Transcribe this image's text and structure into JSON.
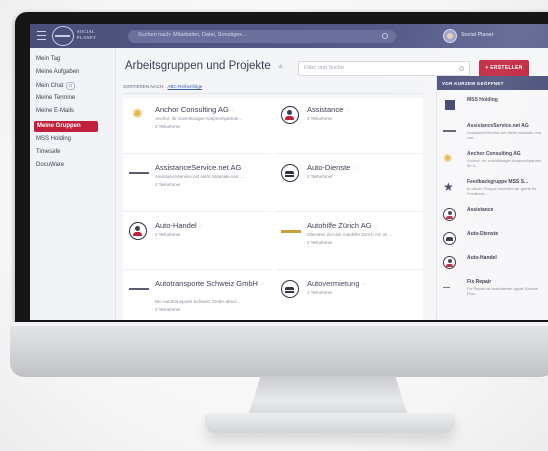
{
  "header": {
    "logo_text": "SOCIAL PLANET",
    "search_placeholder": "Suchen nach: Mitarbeiter, Datei, Sonstiges...",
    "user_name": "Social Planet"
  },
  "sidebar": {
    "items": [
      {
        "label": "Mein Tag"
      },
      {
        "label": "Meine Aufgaben"
      },
      {
        "label": "Mein Chat",
        "count": "0"
      },
      {
        "label": "Meine Termine"
      },
      {
        "label": "Meine E-Mails"
      },
      {
        "label": "Meine Gruppen",
        "active": true
      },
      {
        "label": "MSS Holding"
      },
      {
        "label": "Timesafe"
      },
      {
        "label": "DocuWare"
      }
    ]
  },
  "main": {
    "title": "Arbeitsgruppen und Projekte",
    "filter_placeholder": "Filter und Suche",
    "create_label": "+ ERSTELLEN",
    "sort_label": "SORTIEREN NACH:",
    "sort_value": "ABC-Reihenfolge",
    "groups": [
      {
        "title": "Anchor Consulting AG",
        "desc": "Anchor, Ihr zuverlässiger Ansprechpartner...",
        "members": "2 Teilnehmer",
        "icon": "sun-logo-icon"
      },
      {
        "title": "Assistance",
        "desc": "",
        "members": "3 Teilnehmer",
        "icon": "people-icon"
      },
      {
        "title": "AssistanceService.net AG",
        "desc": "AssistanceService.net steht nationale und ...",
        "members": "2 Teilnehmer",
        "icon": "company-logo-icon"
      },
      {
        "title": "Auto-Dienste",
        "desc": "",
        "members": "2 Teilnehmer",
        "icon": "car-icon"
      },
      {
        "title": "Auto-Handel",
        "desc": "",
        "members": "2 Teilnehmer",
        "icon": "people-icon"
      },
      {
        "title": "Autohilfe Zürich AG",
        "desc": "Oberstes Ziel der Autohilfe Zürich AG ist ...",
        "members": "2 Teilnehmer",
        "icon": "company-logo-icon"
      },
      {
        "title": "Autotransporte Schweiz GmbH",
        "desc": "Die Autotransporte Schweiz GmbH absol...",
        "members": "2 Teilnehmer",
        "icon": "company-logo-icon"
      },
      {
        "title": "Autovermietung",
        "desc": "",
        "members": "1 Teilnehmer",
        "icon": "car-icon"
      }
    ]
  },
  "recent": {
    "heading": "VOR KURZEM GEÖFFNET",
    "items": [
      {
        "title": "MSS Holding",
        "desc": "",
        "icon": "square-logo-icon"
      },
      {
        "title": "AssistanceService.net AG",
        "desc": "AssistanceService.net steht nationale und inte...",
        "icon": "company-logo-icon"
      },
      {
        "title": "Anchor Consulting AG",
        "desc": "Anchor, Ihr zuverlässiger Ansprechpartner für d...",
        "icon": "sun-logo-icon"
      },
      {
        "title": "Feedbackgruppe MSS S...",
        "desc": "In dieser Gruppe möchten wir gerne Ihr Feedback...",
        "icon": "star-icon"
      },
      {
        "title": "Assistance",
        "desc": "",
        "icon": "people-icon"
      },
      {
        "title": "Auto-Dienste",
        "desc": "",
        "icon": "car-icon"
      },
      {
        "title": "Auto-Handel",
        "desc": "",
        "icon": "people-icon"
      },
      {
        "title": "Fix Repair",
        "desc": "Fix Repair ist autorisierter Apple Service Prov...",
        "icon": "text-logo-icon"
      }
    ]
  },
  "colors": {
    "accent": "#c0203a",
    "header": "#4a4f7a"
  }
}
